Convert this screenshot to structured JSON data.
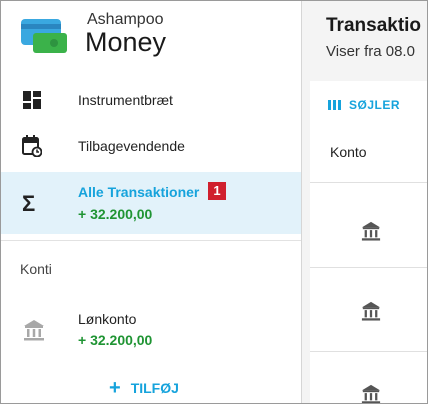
{
  "brand": {
    "small": "Ashampoo",
    "big": "Money"
  },
  "nav": [
    {
      "label": "Instrumentbræt",
      "icon": "dashboard-icon"
    },
    {
      "label": "Tilbagevendende",
      "icon": "calendar-recurring-icon"
    }
  ],
  "active": {
    "label": "Alle Transaktioner",
    "badge": "1",
    "amount": "+ 32.200,00",
    "icon": "sigma-icon"
  },
  "section": {
    "title": "Konti"
  },
  "account": {
    "name": "Lønkonto",
    "amount": "+ 32.200,00",
    "icon": "bank-icon"
  },
  "add": {
    "label": "TILFØJ"
  },
  "main": {
    "title": "Transaktio",
    "subtitle": "Viser fra 08.0",
    "columns_label": "SØJLER",
    "column_header": "Konto"
  },
  "colors": {
    "accent": "#16a3dc",
    "positive": "#1f9433",
    "badge": "#d0202e",
    "active_bg": "#e2f2fa"
  }
}
